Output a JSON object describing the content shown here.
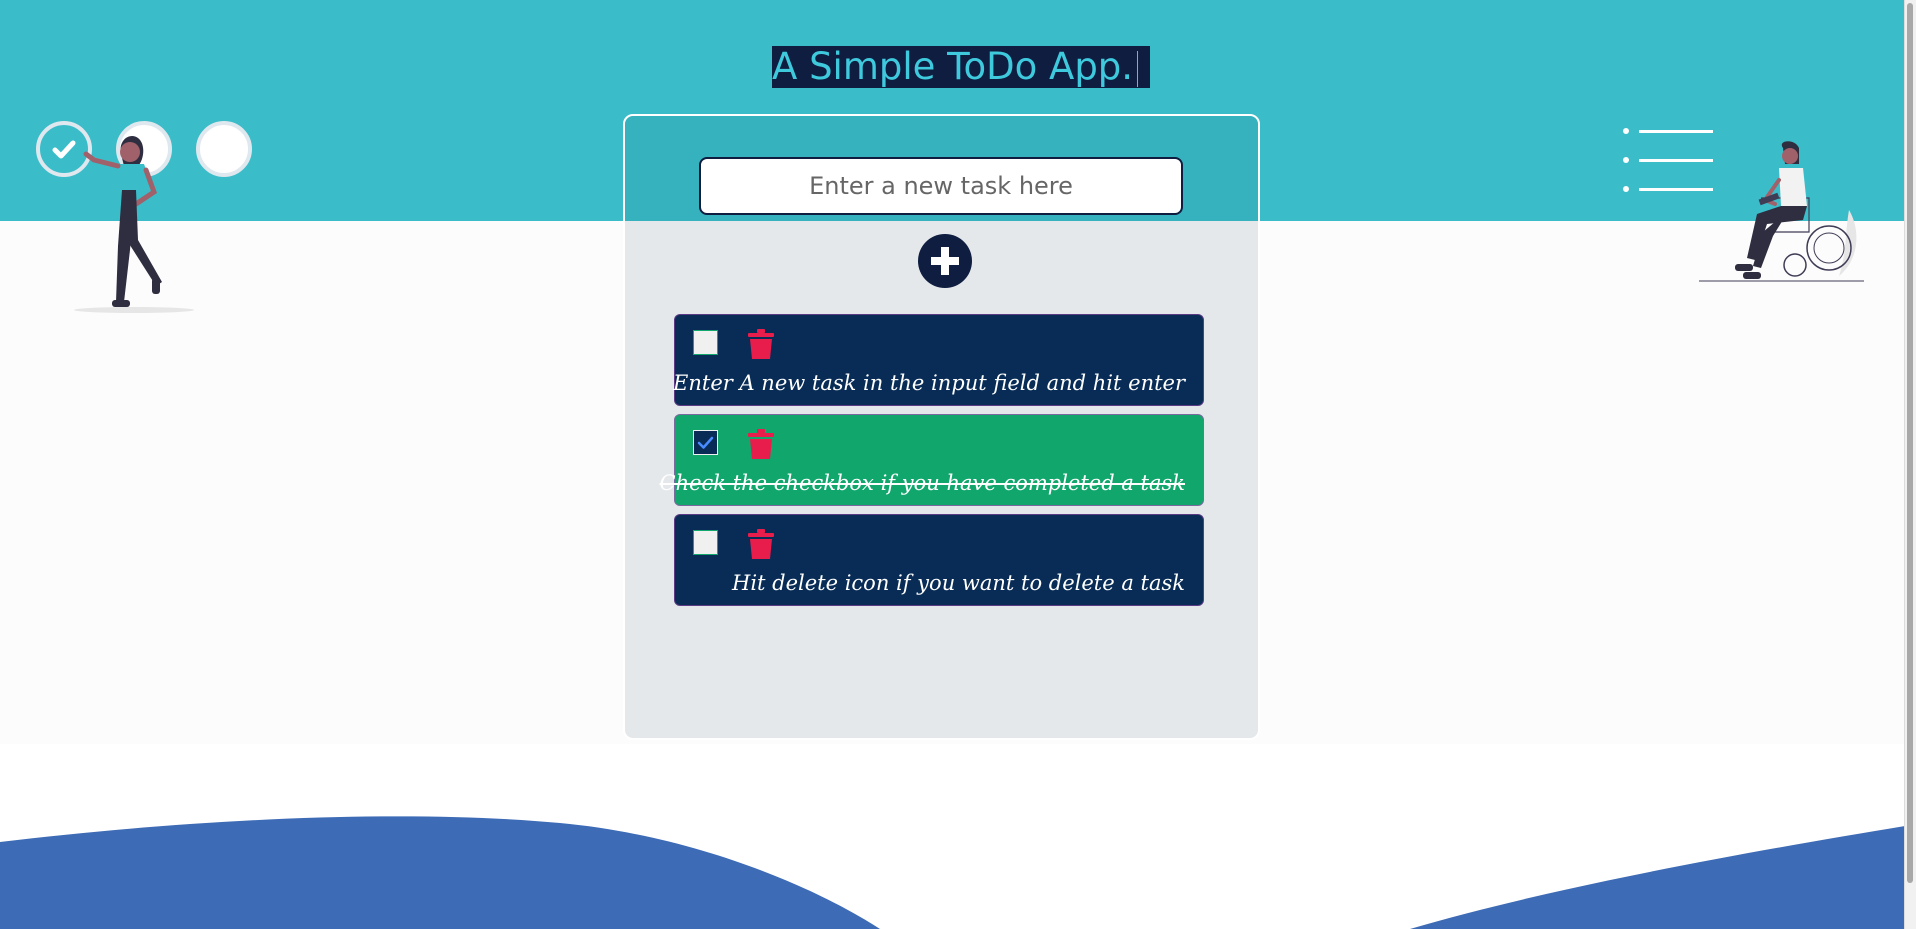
{
  "app": {
    "title": "A Simple ToDo App.",
    "input_placeholder": "Enter a new task here",
    "add_button_icon": "plus-circle-icon"
  },
  "todos": [
    {
      "text": "Enter A new task in the input field and hit enter",
      "completed": false
    },
    {
      "text": "Check the checkbox if you have completed a task",
      "completed": true
    },
    {
      "text": "Hit delete icon if you want to delete a task",
      "completed": false
    }
  ],
  "decor": {
    "progress_circles": {
      "total": 3,
      "checked": 1
    },
    "menu_icon": "list-icon"
  },
  "colors": {
    "header": "#3bbdc9",
    "card_top": "#36b2bf",
    "card_body": "#e4e8eb",
    "task_pending": "#082c56",
    "task_done": "#10a66c",
    "delete": "#e81d4b",
    "navy": "#0e1d40",
    "wave": "#3d6bb6"
  }
}
